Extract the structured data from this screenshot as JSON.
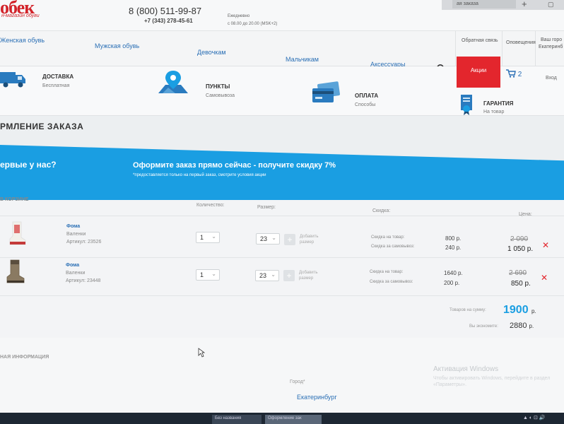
{
  "header": {
    "logo_text": "обек",
    "logo_sub": "н-магазин обуви",
    "phone_main": "8 (800) 511-99-87",
    "phone_local": "+7 (343) 278-45-61",
    "hours_label": "Ежедневно",
    "hours_value": "с 08.00 до 20.00 (MSK+2)"
  },
  "browser": {
    "tab_label": "ая заказа",
    "new_tab": "+",
    "window_icon": "▢"
  },
  "nav": {
    "items": [
      "Женская обувь",
      "Мужская обувь",
      "Девочкам",
      "Мальчикам",
      "Аксессуары"
    ],
    "feedback": "Обратная связь",
    "alerts": "Оповещения",
    "city_line1": "Ваш горо",
    "city_line2": "Екатеринб"
  },
  "features": [
    {
      "title": "ДОСТАВКА",
      "subtitle": "Бесплатная",
      "icon": "truck-icon"
    },
    {
      "title": "ПУНКТЫ",
      "subtitle": "Самовывоза",
      "icon": "map-pin-icon"
    },
    {
      "title": "ОПЛАТА",
      "subtitle": "Способы",
      "icon": "credit-card-icon"
    },
    {
      "title": "ГАРАНТИЯ",
      "subtitle": "На товар",
      "icon": "certificate-icon"
    }
  ],
  "actions": {
    "promo_label": "Акции",
    "cart_count": "2",
    "login_label": "Вход"
  },
  "order": {
    "title": "РМЛЕНИЕ ЗАКАЗА"
  },
  "banner": {
    "left_text": "ервые у нас?",
    "headline": "Оформите заказ прямо сейчас - получите скидку 7%",
    "note": "*предоставляется только на первый заказ, смотрите условия акции"
  },
  "cart": {
    "section_title": "В КОРЗИНЕ",
    "headers": {
      "quantity": "Количество:",
      "size": "Размер:",
      "discount": "Скидка:",
      "price": "Цена:"
    },
    "add_size_label": "Добавить размер",
    "items": [
      {
        "brand": "Фома",
        "type": "Валенки",
        "article": "Артикул: 23526",
        "quantity": "1",
        "size": "23",
        "discount_goods_label": "Скидка на товар:",
        "discount_goods_value": "800 р.",
        "discount_pickup_label": "Скидка за самовывоз:",
        "discount_pickup_value": "240 р.",
        "old_price": "2 090",
        "new_price": "1 050 р.",
        "image": "felt-boot-white-red"
      },
      {
        "brand": "Фома",
        "type": "Валенки",
        "article": "Артикул: 23448",
        "quantity": "1",
        "size": "23",
        "discount_goods_label": "Скидка на товар:",
        "discount_goods_value": "1640 р.",
        "discount_pickup_label": "Скидка за самовывоз:",
        "discount_pickup_value": "200 р.",
        "old_price": "2 690",
        "new_price": "850 р.",
        "image": "felt-boot-brown"
      }
    ],
    "total_label": "Товаров на сумму:",
    "total_value": "1900",
    "total_currency": "р.",
    "saving_label": "Вы экономите:",
    "saving_value": "2880",
    "saving_currency": "р.",
    "remove_glyph": "✕"
  },
  "contact": {
    "section_title": "НАЯ ИНФОРМАЦИЯ",
    "city_label": "Город*",
    "city_value": "Екатеринбург"
  },
  "overlay": {
    "activate_title": "Активация Windows",
    "activate_text": "Чтобы активировать Windows, перейдите в раздел «Параметры»."
  },
  "taskbar": {
    "items": [
      "Без названия",
      "Оформление зак"
    ],
    "tray": "▲ ◐ ⊡ 🔊"
  },
  "colors": {
    "brand_red": "#e3262d",
    "accent_blue": "#1a9ee2",
    "link_blue": "#2a6fb5"
  }
}
